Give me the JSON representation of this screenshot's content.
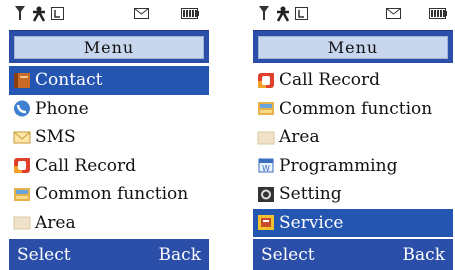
{
  "left_screen": {
    "title": "Menu",
    "items": [
      {
        "label": "Contact",
        "icon": "contact-icon",
        "selected": true
      },
      {
        "label": "Phone",
        "icon": "phone-icon",
        "selected": false
      },
      {
        "label": "SMS",
        "icon": "sms-icon",
        "selected": false
      },
      {
        "label": "Call Record",
        "icon": "call-record-icon",
        "selected": false
      },
      {
        "label": "Common function",
        "icon": "common-function-icon",
        "selected": false
      },
      {
        "label": "Area",
        "icon": "area-icon",
        "selected": false
      }
    ],
    "softkeys": {
      "left": "Select",
      "right": "Back"
    }
  },
  "right_screen": {
    "title": "Menu",
    "items": [
      {
        "label": "Call Record",
        "icon": "call-record-icon",
        "selected": false
      },
      {
        "label": "Common function",
        "icon": "common-function-icon",
        "selected": false
      },
      {
        "label": "Area",
        "icon": "area-icon",
        "selected": false
      },
      {
        "label": "Programming",
        "icon": "programming-icon",
        "selected": false
      },
      {
        "label": "Setting",
        "icon": "setting-icon",
        "selected": false
      },
      {
        "label": "Service",
        "icon": "service-icon",
        "selected": true
      }
    ],
    "softkeys": {
      "left": "Select",
      "right": "Back"
    }
  },
  "colors": {
    "title_bar": "#2b4ea8",
    "title_inner": "#c8d6ee",
    "selection": "#2455b0",
    "softkey_bar": "#2b4ea8"
  },
  "status_icons": [
    "signal-icon",
    "profile-icon",
    "lock-icon",
    "message-icon",
    "battery-icon"
  ]
}
